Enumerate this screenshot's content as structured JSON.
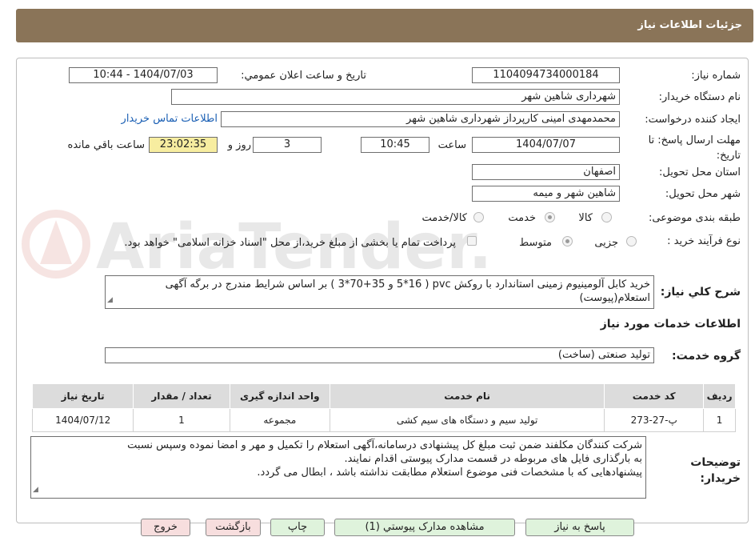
{
  "header": {
    "title": "جزئيات اطلاعات نياز"
  },
  "fields": {
    "need_number_label": "شماره نیاز:",
    "need_number": "1104094734000184",
    "announce_label": "تاريخ و ساعت اعلان عمومي:",
    "announce_value": "1404/07/03 - 10:44",
    "buyer_org_label": "نام دستگاه خریدار:",
    "buyer_org": "شهرداری شاهین شهر",
    "requester_label": "ایجاد کننده درخواست:",
    "requester": "محمدمهدی امینی کارپرداز شهرداری شاهین شهر",
    "contact_link": "اطلاعات تماس خریدار",
    "deadline_label": "مهلت ارسال پاسخ: تا تاریخ:",
    "deadline_date": "1404/07/07",
    "time_label": "ساعت",
    "deadline_time": "10:45",
    "days_value": "3",
    "days_label": "روز و",
    "remaining_time": "23:02:35",
    "remaining_label": "ساعت باقي مانده",
    "province_label": "استان محل تحویل:",
    "province": "اصفهان",
    "city_label": "شهر محل تحویل:",
    "city": "شاهین شهر و میمه",
    "category_label": "طبقه بندی موضوعی:",
    "category_options": [
      "کالا",
      "خدمت",
      "کالا/خدمت"
    ],
    "process_label": "نوع فرآیند خرید :",
    "process_options": [
      "جزیی",
      "متوسط"
    ],
    "payment_note": "پرداخت تمام یا بخشی از مبلغ خرید،از محل \"اسناد خزانه اسلامی\" خواهد بود."
  },
  "summary": {
    "label": "شرح کلي نياز:",
    "text": "خرید کابل آلومینیوم زمینی استاندارد با روکش pvc ( 5*16 و  35+70*3 ) بر اساس شرایط مندرج در برگه آگهی استعلام(پیوست)"
  },
  "services": {
    "section_title": "اطلاعات خدمات مورد نیاز",
    "group_label": "گروه خدمت:",
    "group_value": "تولید صنعتی (ساخت)",
    "columns": [
      "ردیف",
      "کد خدمت",
      "نام خدمت",
      "واحد اندازه گیری",
      "تعداد / مقدار",
      "تاریخ نیاز"
    ],
    "rows": [
      {
        "row": "1",
        "code": "پ-27-273",
        "name": "تولید سیم و دستگاه های سیم کشی",
        "unit": "مجموعه",
        "qty": "1",
        "date": "1404/07/12"
      }
    ]
  },
  "notes": {
    "label": "توضیحات خریدار:",
    "line1": "شرکت کنندگان مکلفند ضمن ثبت مبلغ کل پیشنهادی درسامانه،آگهی استعلام را  تکمیل و مهر و امضا نموده وسپس نسبت",
    "line2": "به بارگذاری فایل های مربوطه در قسمت مدارک پیوستی اقدام نمایند.",
    "line3": "پیشنهادهایی که با مشخصات فنی موضوع استعلام مطابقت نداشته باشد ، ابطال می گردد."
  },
  "buttons": {
    "reply": "پاسخ به نیاز",
    "attachments": "مشاهده مدارک پیوستي (1)",
    "print": "چاپ",
    "back": "بازگشت",
    "exit": "خروج"
  },
  "watermark_text": "AriaTender.neT",
  "colors": {
    "header": "#8a7458",
    "time_highlight": "#f7eda0",
    "button_green": "#dff3dc",
    "button_pink": "#f7dede",
    "link": "#1a5fb4"
  }
}
